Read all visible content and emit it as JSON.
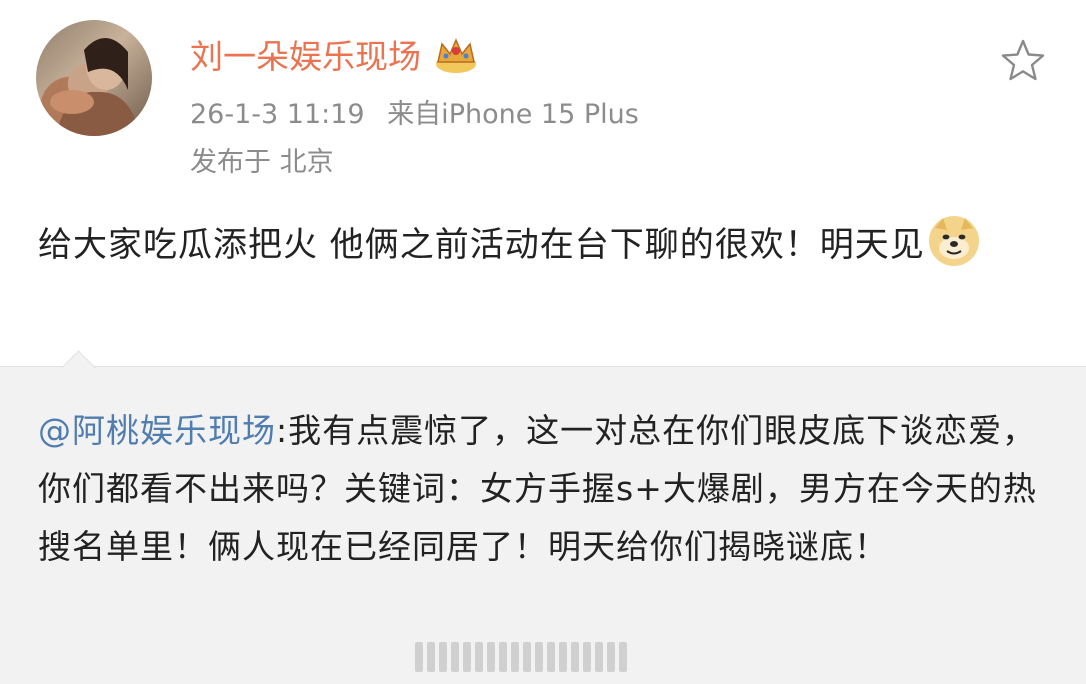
{
  "post": {
    "author": "刘一朵娱乐现场",
    "timestamp": "26-1-3 11:19",
    "source": "来自iPhone 15 Plus",
    "location": "发布于 北京",
    "text": "给大家吃瓜添把火 他俩之前活动在台下聊的很欢！明天见",
    "emoji": "doge-emoji",
    "badge_icon": "crown-icon",
    "favorite_icon": "star-icon"
  },
  "repost": {
    "mention": "@阿桃娱乐现场",
    "text": ":我有点震惊了，这一对总在你们眼皮底下谈恋爱，你们都看不出来吗？关键词：女方手握s+大爆剧，男方在今天的热搜名单里！俩人现在已经同居了！明天给你们揭晓谜底！"
  },
  "colors": {
    "author": "#eb7350",
    "meta": "#8c8c8c",
    "mention": "#507daf",
    "repost_bg": "#f2f2f2"
  }
}
